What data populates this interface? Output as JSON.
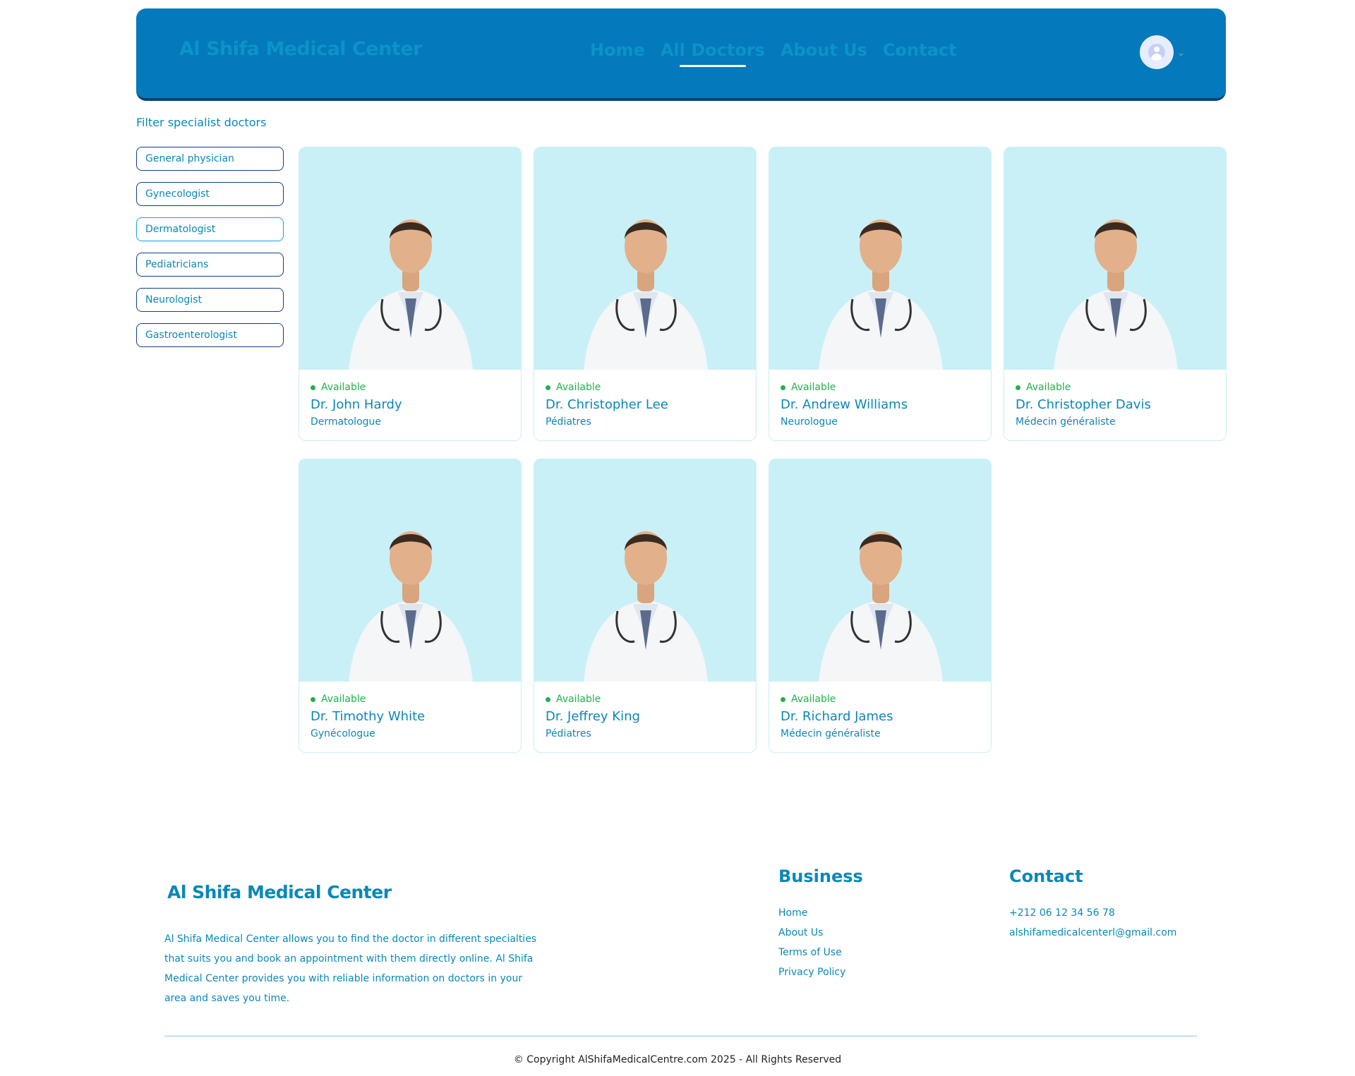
{
  "header": {
    "brand": "Al Shifa Medical Center",
    "nav": [
      "Home",
      "All Doctors",
      "About Us",
      "Contact"
    ],
    "active_nav": "All Doctors",
    "avatar_icon": "user-icon"
  },
  "filter": {
    "title": "Filter specialist doctors",
    "options": [
      "General physician",
      "Gynecologist",
      "Dermatologist",
      "Pediatricians",
      "Neurologist",
      "Gastroenterologist"
    ]
  },
  "doctors": [
    {
      "status": "Available",
      "name": "Dr. John Hardy",
      "specialty": "Dermatologue"
    },
    {
      "status": "Available",
      "name": "Dr. Christopher Lee",
      "specialty": "Pédiatres"
    },
    {
      "status": "Available",
      "name": "Dr. Andrew Williams",
      "specialty": "Neurologue"
    },
    {
      "status": "Available",
      "name": "Dr. Christopher Davis",
      "specialty": "Médecin généraliste"
    },
    {
      "status": "Available",
      "name": "Dr. Timothy White",
      "specialty": "Gynécologue"
    },
    {
      "status": "Available",
      "name": "Dr. Jeffrey King",
      "specialty": "Pédiatres"
    },
    {
      "status": "Available",
      "name": "Dr. Richard James",
      "specialty": "Médecin généraliste"
    }
  ],
  "footer": {
    "brand": "Al Shifa Medical Center",
    "description": "Al Shifa Medical Center allows you to find the doctor in different specialties that suits you and book an appointment with them directly online. Al Shifa Medical Center provides you with reliable information on doctors in your area and saves you time.",
    "business": {
      "title": "Business",
      "links": [
        "Home",
        "About Us",
        "Terms of Use",
        "Privacy Policy"
      ]
    },
    "contact": {
      "title": "Contact",
      "items": [
        "+212 06 12 34 56 78",
        "alshifamedicalcenterl@gmail.com"
      ]
    },
    "copyright": "© Copyright AlShifaMedicalCentre.com 2025 - All Rights Reserved"
  },
  "colors": {
    "header_bg": "#0479bb",
    "primary_text": "#0a88b8",
    "available": "#20b14c",
    "photo_bg": "#c9f0f7"
  }
}
